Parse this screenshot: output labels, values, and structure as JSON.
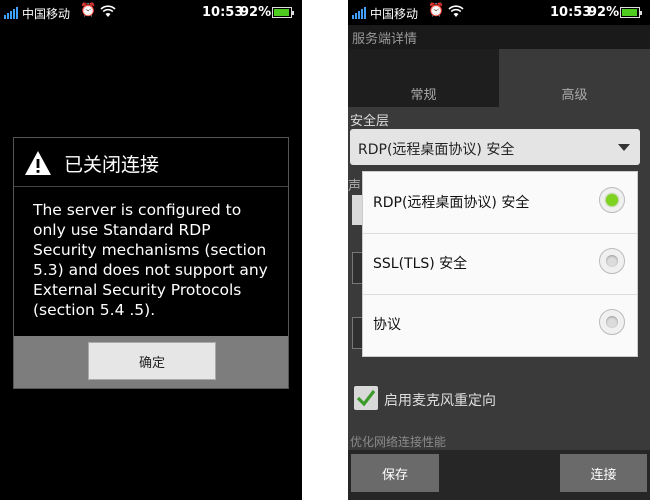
{
  "status_bar": {
    "carrier": "中国移动",
    "time": "10:53",
    "battery_percent": "92%",
    "battery_color": "#4ecb1f",
    "icons": [
      "signal-icon",
      "alarm-icon",
      "wifi-icon",
      "battery-icon"
    ]
  },
  "left_screen": {
    "dialog": {
      "title": "已关闭连接",
      "title_icon": "warning-icon",
      "message": "The server is configured to only use Standard RDP Security mechanisms (section 5.3) and does not support any External Security Protocols (section 5.4 .5).",
      "ok_label": "确定"
    }
  },
  "right_screen": {
    "header_title": "服务端详情",
    "tabs": [
      {
        "label": "常规",
        "selected": false
      },
      {
        "label": "高级",
        "selected": true
      }
    ],
    "security_label": "安全层",
    "security_value": "RDP(远程桌面协议) 安全",
    "partial_label": "声",
    "security_options": [
      {
        "label": "RDP(远程桌面协议) 安全",
        "selected": true
      },
      {
        "label": "SSL(TLS) 安全",
        "selected": false
      },
      {
        "label": "协议",
        "selected": false
      }
    ],
    "mic_redirect_label": "启用麦克风重定向",
    "mic_redirect_checked": true,
    "optimize_label": "优化网络连接性能",
    "save_label": "保存",
    "connect_label": "连接",
    "radio_selected_color": "#7ed321"
  }
}
